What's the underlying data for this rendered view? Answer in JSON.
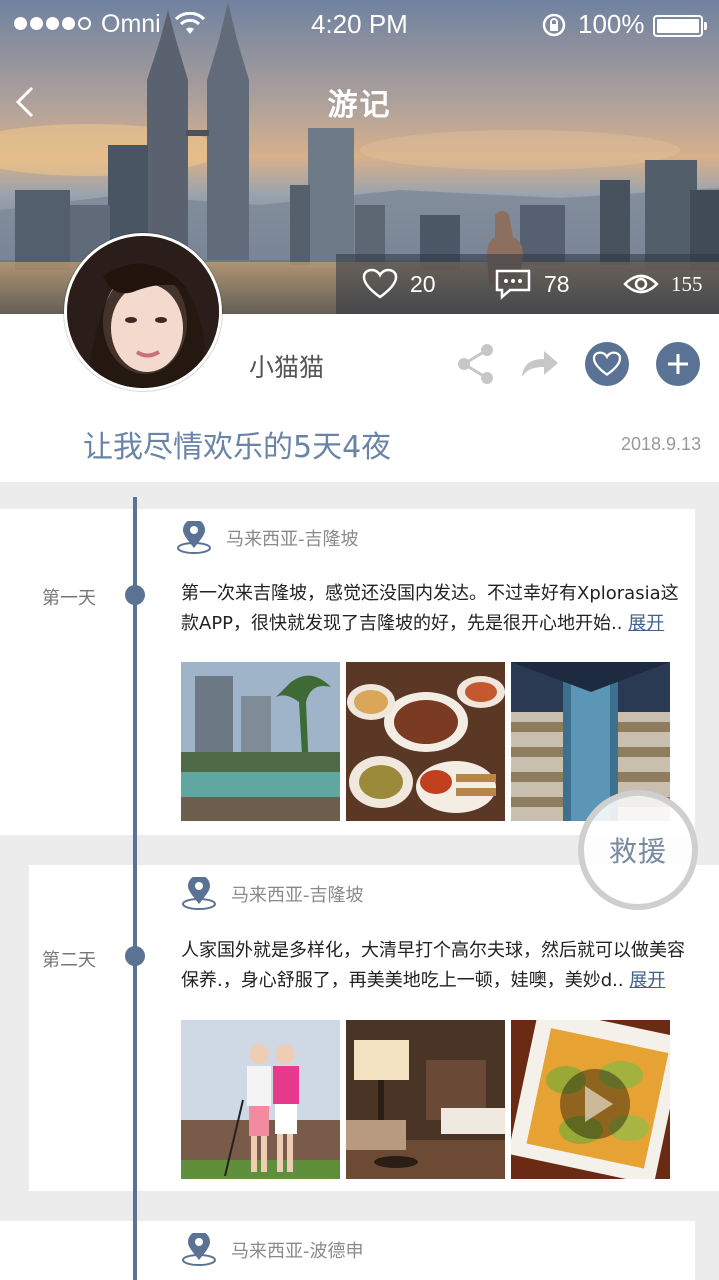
{
  "status_bar": {
    "carrier": "Omni",
    "time": "4:20 PM",
    "battery": "100%",
    "battery_level": 1.0,
    "signal_bars_filled": 4,
    "signal_bars_total": 5
  },
  "nav": {
    "title": "游记",
    "back_icon": "chevron-left-icon"
  },
  "stats": {
    "likes": "20",
    "comments": "78",
    "views": "155"
  },
  "profile": {
    "username": "小猫猫",
    "actions": [
      "share-icon",
      "forward-icon",
      "heart-icon",
      "plus-icon"
    ]
  },
  "trip": {
    "title": "让我尽情欢乐的5天4夜",
    "date": "2018.9.13"
  },
  "days": [
    {
      "label": "第一天",
      "location": "马来西亚-吉隆坡",
      "text": "第一次来吉隆坡，感觉还没国内发达。不过幸好有Xplorasia这款APP，很快就发现了吉隆坡的好，先是很开心地开始..",
      "expand": "展开",
      "photos": [
        "hotel-pool-photo",
        "food-platter-photo",
        "shopping-mall-photo"
      ]
    },
    {
      "label": "第二天",
      "location": "马来西亚-吉隆坡",
      "text": "人家国外就是多样化，大清早打个高尔夫球，然后就可以做美容保养.，身心舒服了，再美美地吃上一顿，娃噢，美妙d..",
      "expand": "展开",
      "photos": [
        "golf-couple-photo",
        "hotel-room-photo",
        "curry-dish-video"
      ]
    },
    {
      "location": "马来西亚-波德申"
    }
  ],
  "rescue_button": "救援",
  "colors": {
    "accent": "#5a7394",
    "title_blue": "#6a84a8",
    "link": "#3f5f8c"
  }
}
